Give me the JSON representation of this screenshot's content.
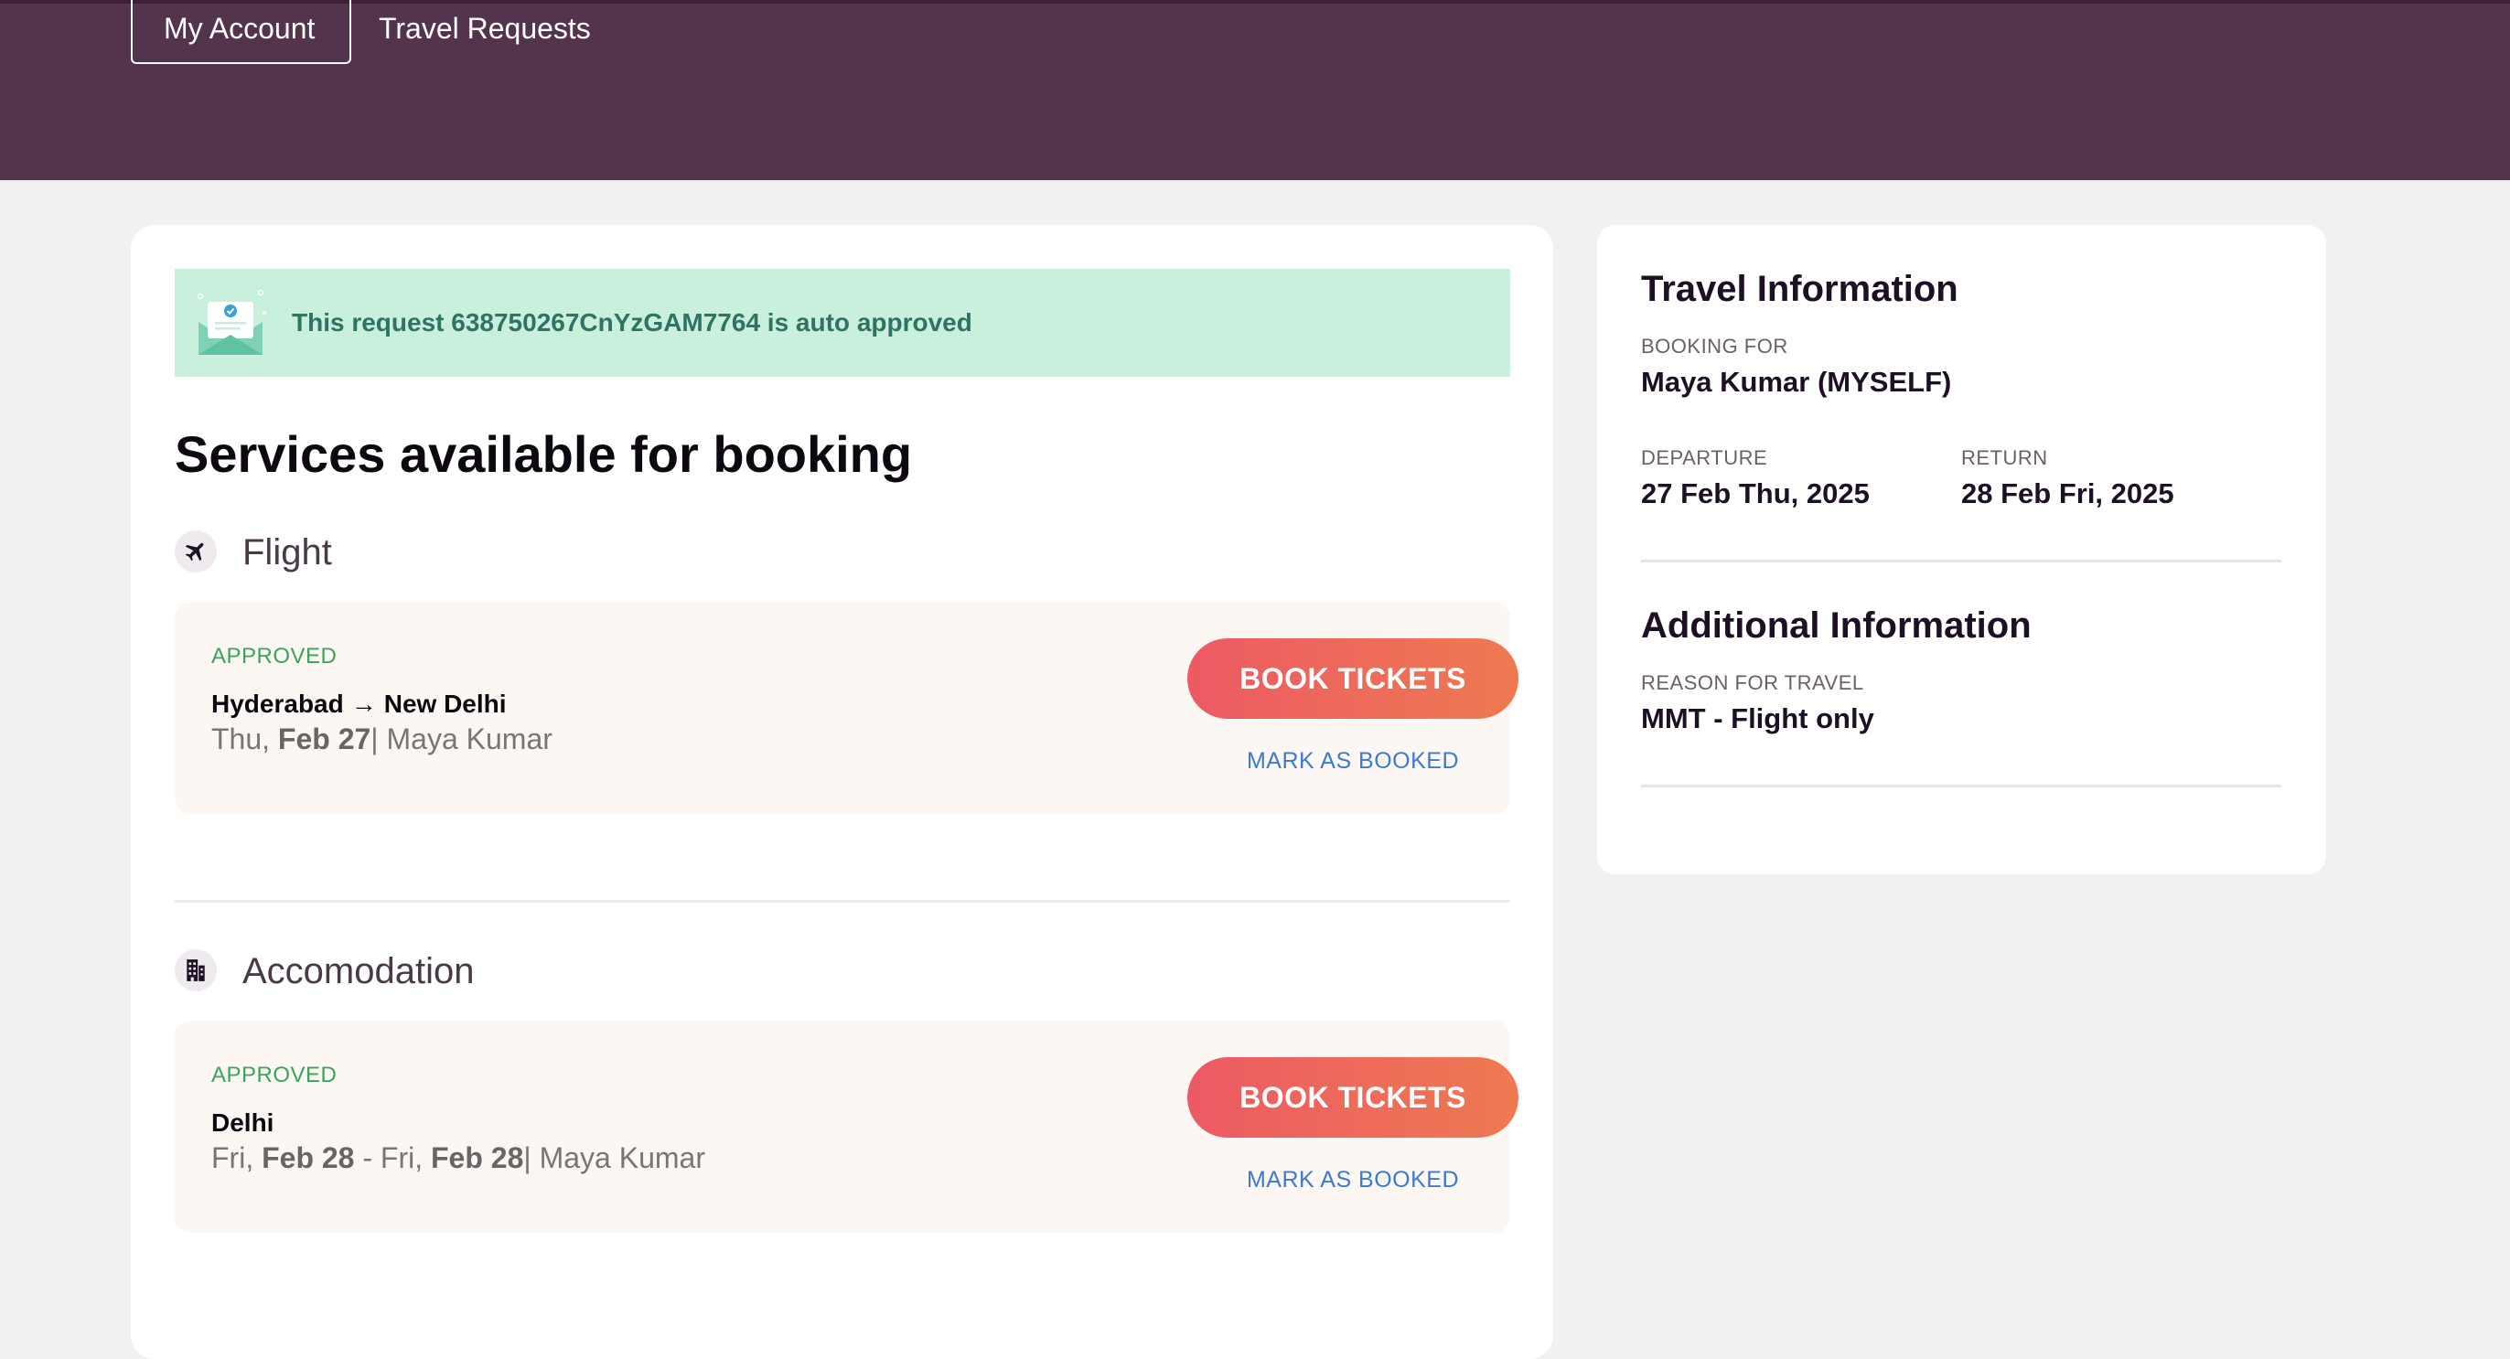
{
  "nav": {
    "tabs": [
      {
        "label": "My Account"
      },
      {
        "label": "Travel Requests"
      }
    ]
  },
  "banner": {
    "text": "This request 638750267CnYzGAM7764 is auto approved",
    "icon": "envelope-check-icon"
  },
  "main": {
    "title": "Services available for booking",
    "services": [
      {
        "name": "Flight",
        "icon": "airplane-icon",
        "status": "APPROVED",
        "from": "Hyderabad",
        "to": "New Delhi",
        "day": "Thu,",
        "date": "Feb 27",
        "traveler": "| Maya Kumar",
        "book_label": "BOOK TICKETS",
        "mark_label": "MARK AS BOOKED"
      },
      {
        "name": "Accomodation",
        "icon": "hotel-icon",
        "status": "APPROVED",
        "city": "Delhi",
        "start_day": "Fri,",
        "start_date": "Feb 28",
        "sep": " - Fri,",
        "end_date": "Feb 28",
        "traveler": "| Maya Kumar",
        "book_label": "BOOK TICKETS",
        "mark_label": "MARK AS BOOKED"
      }
    ]
  },
  "travel_info": {
    "title": "Travel Information",
    "booking_for_label": "BOOKING FOR",
    "booking_for": "Maya Kumar (MYSELF)",
    "departure_label": "DEPARTURE",
    "departure": "27 Feb Thu, 2025",
    "return_label": "RETURN",
    "return": "28 Feb Fri, 2025"
  },
  "additional_info": {
    "title": "Additional Information",
    "reason_label": "REASON FOR TRAVEL",
    "reason": "MMT - Flight only"
  },
  "colors": {
    "header": "#54344c",
    "banner_bg": "#c8f0dc",
    "approved": "#3aa35c",
    "button_start": "#ec5a63",
    "button_end": "#ef7a52",
    "link": "#3a7bd0"
  }
}
